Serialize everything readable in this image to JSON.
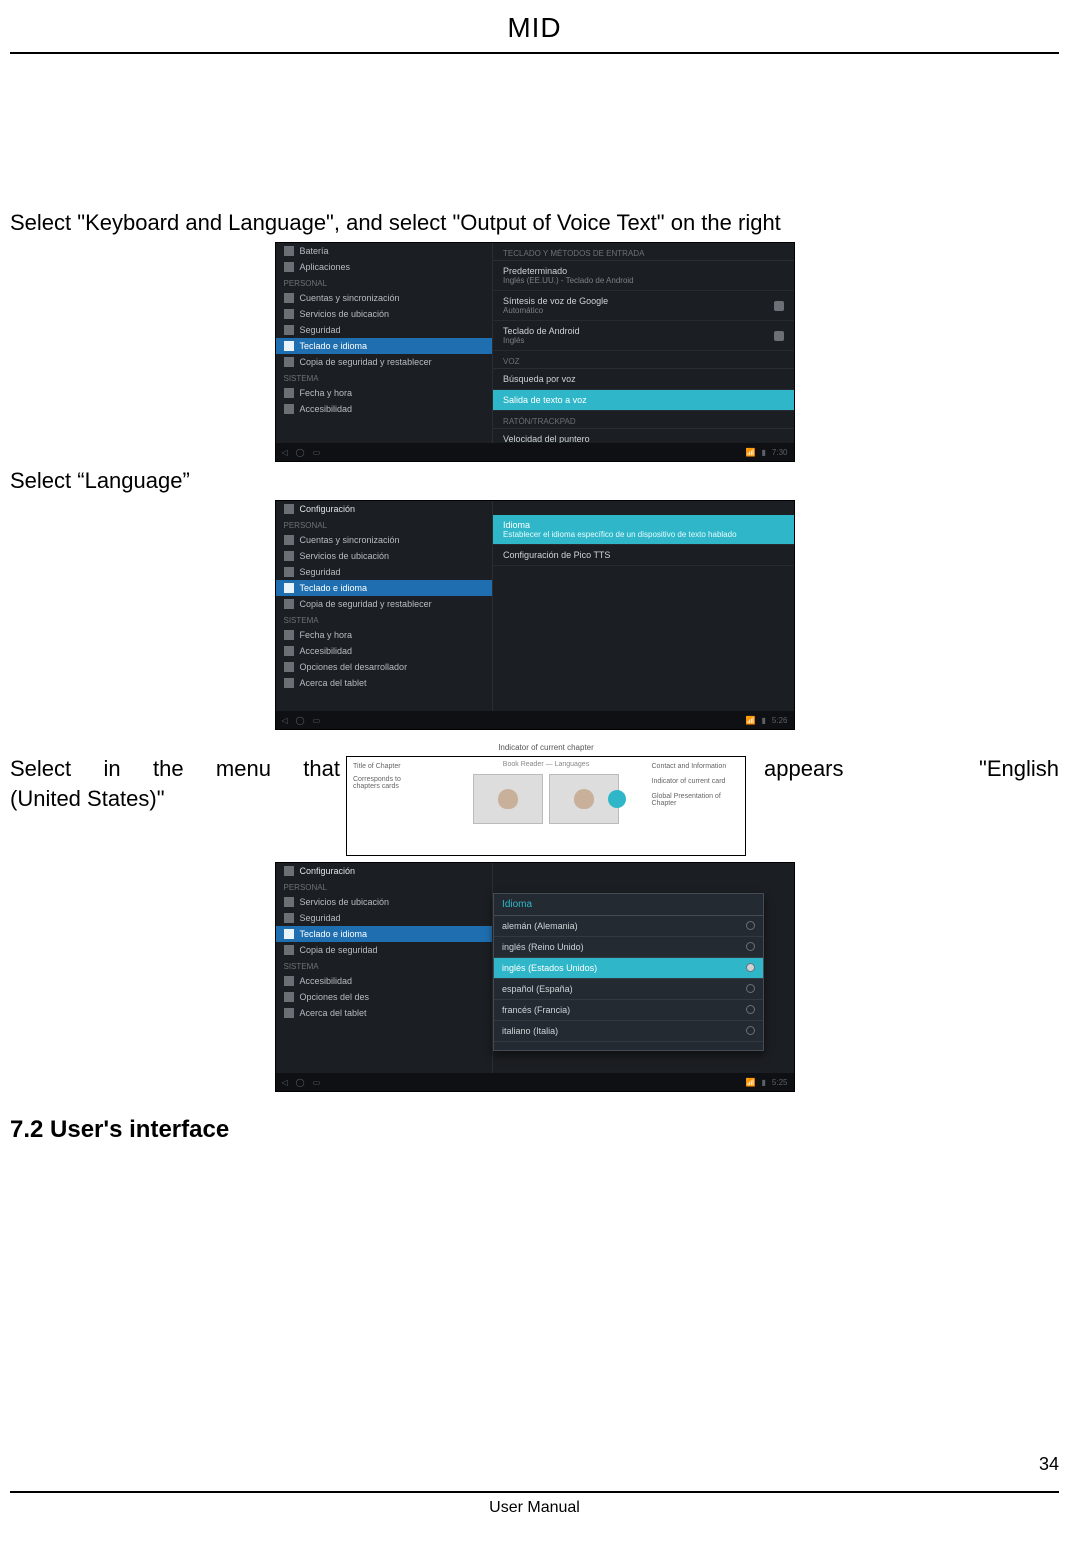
{
  "header": {
    "title": "MID"
  },
  "body": {
    "step1": "Select \"Keyboard and Language\", and select \"Output of Voice Text\" on the right",
    "step2": "Select “Language”",
    "step3_left": "Select in the menu that",
    "step3_mid": "appears",
    "step3_right": "\"English",
    "step3_cont": "(United States)\"",
    "section": "7.2 User's interface"
  },
  "footer": {
    "label": "User Manual",
    "page": "34"
  },
  "shot1": {
    "sidebar_head": "",
    "sidebar": [
      {
        "icon": true,
        "label": "Batería"
      },
      {
        "icon": true,
        "label": "Aplicaciones"
      }
    ],
    "sidebar_group2_head": "PERSONAL",
    "sidebar_group2": [
      {
        "icon": true,
        "label": "Cuentas y sincronización"
      },
      {
        "icon": true,
        "label": "Servicios de ubicación"
      },
      {
        "icon": true,
        "label": "Seguridad"
      },
      {
        "icon": true,
        "label": "Teclado e idioma",
        "selected": true
      },
      {
        "icon": true,
        "label": "Copia de seguridad y restablecer"
      }
    ],
    "sidebar_group3_head": "SISTEMA",
    "sidebar_group3": [
      {
        "icon": true,
        "label": "Fecha y hora"
      },
      {
        "icon": true,
        "label": "Accesibilidad"
      }
    ],
    "main_head": "TECLADO Y MÉTODOS DE ENTRADA",
    "main": [
      {
        "label": "Predeterminado",
        "sub": "Inglés (EE.UU.) - Teclado de Android"
      },
      {
        "label": "Síntesis de voz de Google",
        "sub": "Automático",
        "gear": true
      },
      {
        "label": "Teclado de Android",
        "sub": "Inglés",
        "gear": true
      }
    ],
    "main_head2": "VOZ",
    "main2": [
      {
        "label": "Búsqueda por voz"
      },
      {
        "label": "Salida de texto a voz",
        "selected": true
      }
    ],
    "main_head3": "RATÓN/TRACKPAD",
    "main3": [
      {
        "label": "Velocidad del puntero"
      }
    ],
    "navbar_time": "7:30"
  },
  "shot2": {
    "title": "Configuración",
    "sidebar_group_head": "PERSONAL",
    "sidebar": [
      {
        "icon": true,
        "label": "Cuentas y sincronización"
      },
      {
        "icon": true,
        "label": "Servicios de ubicación"
      },
      {
        "icon": true,
        "label": "Seguridad"
      },
      {
        "icon": true,
        "label": "Teclado e idioma",
        "selected": true
      },
      {
        "icon": true,
        "label": "Copia de seguridad y restablecer"
      }
    ],
    "sidebar_group2_head": "SISTEMA",
    "sidebar_group2": [
      {
        "icon": true,
        "label": "Fecha y hora"
      },
      {
        "icon": true,
        "label": "Accesibilidad"
      },
      {
        "icon": true,
        "label": "Opciones del desarrollador"
      },
      {
        "icon": true,
        "label": "Acerca del tablet"
      }
    ],
    "main": [
      {
        "label": "Idioma",
        "sub": "Establecer el idioma específico de un dispositivo de texto hablado",
        "selected": true
      },
      {
        "label": "Configuración de Pico TTS"
      }
    ],
    "navbar_time": "5:26"
  },
  "shot3": {
    "top_caption": "Indicator of current chapter",
    "left_title": "Title of Chapter",
    "left_sub1": "Corresponds to",
    "left_sub2": "chapters cards",
    "mid_brand": "Book Reader — Languages",
    "right1": "Contact and Information",
    "right2": "Indicator of current card",
    "right3": "Global Presentation of Chapter"
  },
  "shot4": {
    "title": "Configuración",
    "sidebar_group_head": "PERSONAL",
    "sidebar": [
      {
        "icon": true,
        "label": "Servicios de ubicación"
      },
      {
        "icon": true,
        "label": "Seguridad"
      },
      {
        "icon": true,
        "label": "Teclado e idioma",
        "selected": true
      },
      {
        "icon": true,
        "label": "Copia de seguridad"
      }
    ],
    "sidebar_group2_head": "SISTEMA",
    "sidebar_group2": [
      {
        "icon": true,
        "label": "Accesibilidad"
      },
      {
        "icon": true,
        "label": "Opciones del des"
      },
      {
        "icon": true,
        "label": "Acerca del tablet"
      }
    ],
    "dialog_title": "Idioma",
    "options": [
      {
        "label": "alemán (Alemania)",
        "selected": false
      },
      {
        "label": "inglés (Reino Unido)",
        "selected": false
      },
      {
        "label": "inglés (Estados Unidos)",
        "selected": true
      },
      {
        "label": "español (España)",
        "selected": false
      },
      {
        "label": "francés (Francia)",
        "selected": false
      },
      {
        "label": "italiano (Italia)",
        "selected": false
      }
    ],
    "navbar_time": "5:25"
  }
}
